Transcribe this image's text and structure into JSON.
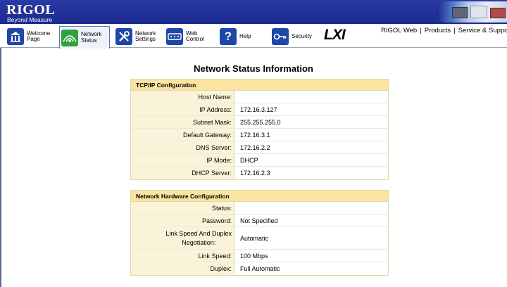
{
  "header": {
    "brand": "RIGOL",
    "tagline": "Beyond Measure"
  },
  "nav": {
    "items": [
      {
        "label": "Welcome\nPage",
        "icon": "home-icon"
      },
      {
        "label": "Network\nStatus",
        "icon": "network-status-icon"
      },
      {
        "label": "Network\nSettings",
        "icon": "tools-icon"
      },
      {
        "label": "Web\nControl",
        "icon": "web-control-icon"
      },
      {
        "label": "Help",
        "icon": "help-icon"
      },
      {
        "label": "Security",
        "icon": "key-icon"
      }
    ],
    "lxi": "LXI",
    "links": [
      "RIGOL Web",
      "Products",
      "Service & Suppor"
    ],
    "separator": "|"
  },
  "page": {
    "title": "Network Status Information"
  },
  "tcpip": {
    "heading": "TCP/IP Configuration",
    "rows": [
      {
        "label": "Host Name:",
        "value": ""
      },
      {
        "label": "IP Address:",
        "value": "172.16.3.127"
      },
      {
        "label": "Subnet Mask:",
        "value": "255.255.255.0"
      },
      {
        "label": "Default Gateway:",
        "value": "172.16.3.1"
      },
      {
        "label": "DNS Server:",
        "value": "172.16.2.2"
      },
      {
        "label": "IP Mode:",
        "value": "DHCP"
      },
      {
        "label": "DHCP Server:",
        "value": "172.16.2.3"
      }
    ]
  },
  "hardware": {
    "heading": "Network Hardware Configuration",
    "rows": [
      {
        "label": "Status:",
        "value": ""
      },
      {
        "label": "Password:",
        "value": "Not Specified"
      },
      {
        "label": "Link Speed And Duplex\nNegotiation:",
        "value": "Automatic"
      },
      {
        "label": "Link Speed:",
        "value": "100 Mbps"
      },
      {
        "label": "Duplex:",
        "value": "Full Automatic"
      }
    ]
  },
  "colors": {
    "header": "#1c2a8e",
    "section_head": "#fbe3a0",
    "label_cell": "#fbf3d8",
    "status_icon": "#2fa33a"
  }
}
